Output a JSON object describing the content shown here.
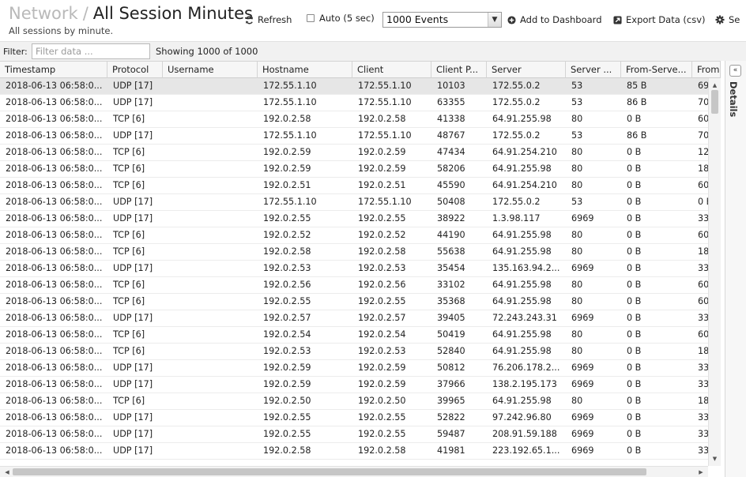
{
  "header": {
    "breadcrumb_parent": "Network",
    "breadcrumb_separator": "/",
    "title": "All Session Minutes",
    "subtitle": "All sessions by minute.",
    "refresh_label": "Refresh",
    "auto_label": "Auto (5 sec)",
    "auto_checked": false,
    "events_select": "1000 Events",
    "add_dashboard_label": "Add to Dashboard",
    "export_label": "Export Data (csv)",
    "settings_label": "Se"
  },
  "filter": {
    "label": "Filter:",
    "placeholder": "Filter data ...",
    "value": "",
    "showing": "Showing 1000 of 1000"
  },
  "details_panel": {
    "label": "Details",
    "toggle_glyph": "«"
  },
  "columns": [
    "Timestamp",
    "Protocol",
    "Username",
    "Hostname",
    "Client",
    "Client P...",
    "Server",
    "Server ...",
    "From-Serve...",
    "From"
  ],
  "rows": [
    [
      "2018-06-13 06:58:0...",
      "UDP [17]",
      "",
      "172.55.1.10",
      "172.55.1.10",
      "10103",
      "172.55.0.2",
      "53",
      "85 B",
      "69"
    ],
    [
      "2018-06-13 06:58:0...",
      "UDP [17]",
      "",
      "172.55.1.10",
      "172.55.1.10",
      "63355",
      "172.55.0.2",
      "53",
      "86 B",
      "70"
    ],
    [
      "2018-06-13 06:58:0...",
      "TCP [6]",
      "",
      "192.0.2.58",
      "192.0.2.58",
      "41338",
      "64.91.255.98",
      "80",
      "0 B",
      "60"
    ],
    [
      "2018-06-13 06:58:0...",
      "UDP [17]",
      "",
      "172.55.1.10",
      "172.55.1.10",
      "48767",
      "172.55.0.2",
      "53",
      "86 B",
      "70"
    ],
    [
      "2018-06-13 06:58:0...",
      "TCP [6]",
      "",
      "192.0.2.59",
      "192.0.2.59",
      "47434",
      "64.91.254.210",
      "80",
      "0 B",
      "12"
    ],
    [
      "2018-06-13 06:58:0...",
      "TCP [6]",
      "",
      "192.0.2.59",
      "192.0.2.59",
      "58206",
      "64.91.255.98",
      "80",
      "0 B",
      "18"
    ],
    [
      "2018-06-13 06:58:0...",
      "TCP [6]",
      "",
      "192.0.2.51",
      "192.0.2.51",
      "45590",
      "64.91.254.210",
      "80",
      "0 B",
      "60"
    ],
    [
      "2018-06-13 06:58:0...",
      "UDP [17]",
      "",
      "172.55.1.10",
      "172.55.1.10",
      "50408",
      "172.55.0.2",
      "53",
      "0 B",
      "0 E"
    ],
    [
      "2018-06-13 06:58:0...",
      "UDP [17]",
      "",
      "192.0.2.55",
      "192.0.2.55",
      "38922",
      "1.3.98.117",
      "6969",
      "0 B",
      "33"
    ],
    [
      "2018-06-13 06:58:0...",
      "TCP [6]",
      "",
      "192.0.2.52",
      "192.0.2.52",
      "44190",
      "64.91.255.98",
      "80",
      "0 B",
      "60"
    ],
    [
      "2018-06-13 06:58:0...",
      "TCP [6]",
      "",
      "192.0.2.58",
      "192.0.2.58",
      "55638",
      "64.91.255.98",
      "80",
      "0 B",
      "18"
    ],
    [
      "2018-06-13 06:58:0...",
      "UDP [17]",
      "",
      "192.0.2.53",
      "192.0.2.53",
      "35454",
      "135.163.94.2...",
      "6969",
      "0 B",
      "33"
    ],
    [
      "2018-06-13 06:58:0...",
      "TCP [6]",
      "",
      "192.0.2.56",
      "192.0.2.56",
      "33102",
      "64.91.255.98",
      "80",
      "0 B",
      "60"
    ],
    [
      "2018-06-13 06:58:0...",
      "TCP [6]",
      "",
      "192.0.2.55",
      "192.0.2.55",
      "35368",
      "64.91.255.98",
      "80",
      "0 B",
      "60"
    ],
    [
      "2018-06-13 06:58:0...",
      "UDP [17]",
      "",
      "192.0.2.57",
      "192.0.2.57",
      "39405",
      "72.243.243.31",
      "6969",
      "0 B",
      "33"
    ],
    [
      "2018-06-13 06:58:0...",
      "TCP [6]",
      "",
      "192.0.2.54",
      "192.0.2.54",
      "50419",
      "64.91.255.98",
      "80",
      "0 B",
      "60"
    ],
    [
      "2018-06-13 06:58:0...",
      "TCP [6]",
      "",
      "192.0.2.53",
      "192.0.2.53",
      "52840",
      "64.91.255.98",
      "80",
      "0 B",
      "18"
    ],
    [
      "2018-06-13 06:58:0...",
      "UDP [17]",
      "",
      "192.0.2.59",
      "192.0.2.59",
      "50812",
      "76.206.178.2...",
      "6969",
      "0 B",
      "33"
    ],
    [
      "2018-06-13 06:58:0...",
      "UDP [17]",
      "",
      "192.0.2.59",
      "192.0.2.59",
      "37966",
      "138.2.195.173",
      "6969",
      "0 B",
      "33"
    ],
    [
      "2018-06-13 06:58:0...",
      "TCP [6]",
      "",
      "192.0.2.50",
      "192.0.2.50",
      "39965",
      "64.91.255.98",
      "80",
      "0 B",
      "18"
    ],
    [
      "2018-06-13 06:58:0...",
      "UDP [17]",
      "",
      "192.0.2.55",
      "192.0.2.55",
      "52822",
      "97.242.96.80",
      "6969",
      "0 B",
      "33"
    ],
    [
      "2018-06-13 06:58:0...",
      "UDP [17]",
      "",
      "192.0.2.55",
      "192.0.2.55",
      "59487",
      "208.91.59.188",
      "6969",
      "0 B",
      "33"
    ],
    [
      "2018-06-13 06:58:0...",
      "UDP [17]",
      "",
      "192.0.2.58",
      "192.0.2.58",
      "41981",
      "223.192.65.1...",
      "6969",
      "0 B",
      "33"
    ]
  ],
  "selected_row": 0,
  "colors": {
    "selected_row_bg": "#e6e6e6",
    "header_bg": "#f6f6f6",
    "filter_bar_bg": "#f1f1f1",
    "breadcrumb_parent": "#b9b9b9"
  }
}
